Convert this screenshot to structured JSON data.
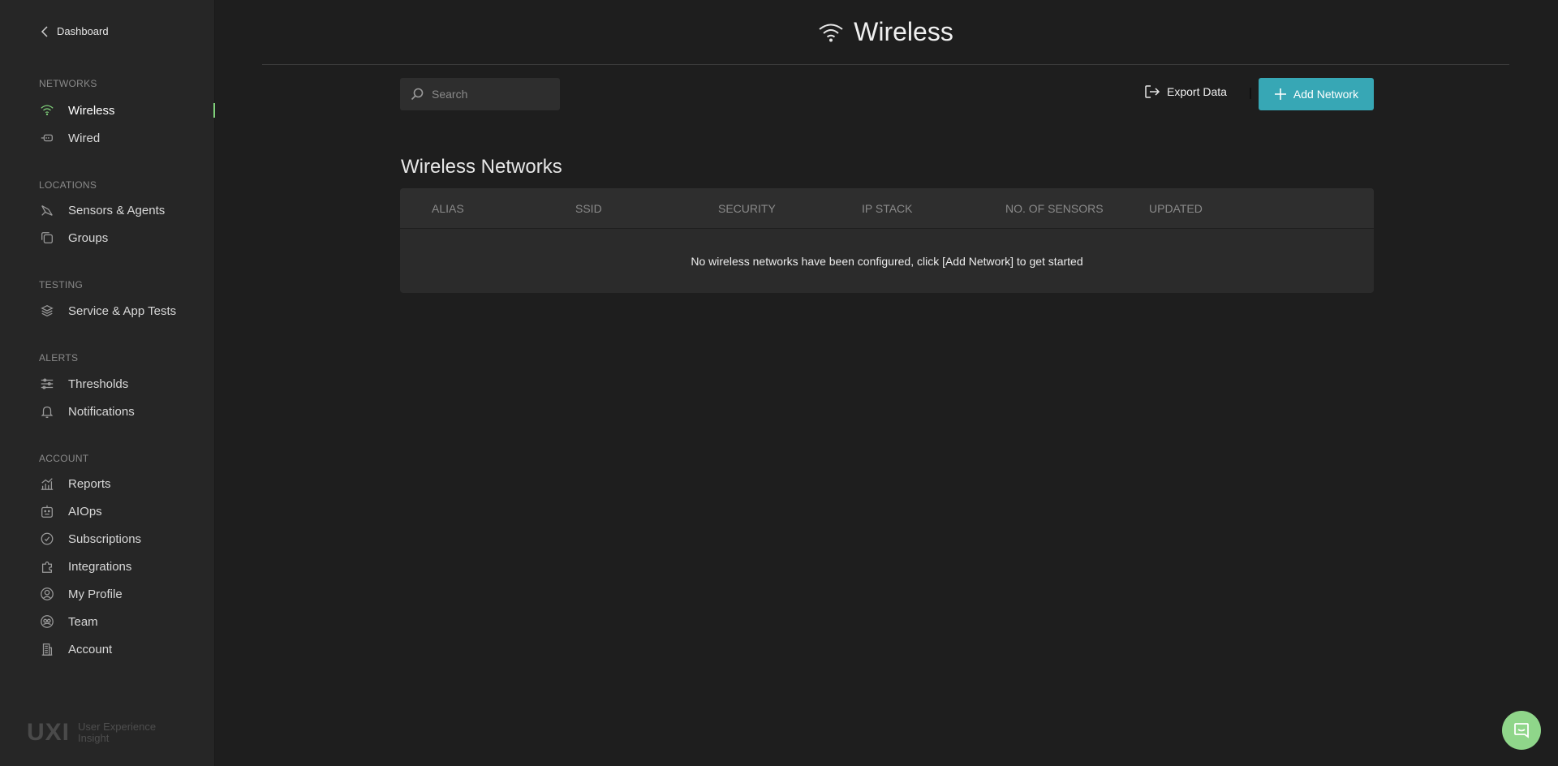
{
  "sidebar": {
    "back_label": "Dashboard",
    "sections": {
      "networks": "NETWORKS",
      "locations": "LOCATIONS",
      "testing": "TESTING",
      "alerts": "ALERTS",
      "account": "ACCOUNT"
    },
    "items": {
      "wireless": "Wireless",
      "wired": "Wired",
      "sensors": "Sensors & Agents",
      "groups": "Groups",
      "tests": "Service & App Tests",
      "thresholds": "Thresholds",
      "notifications": "Notifications",
      "reports": "Reports",
      "aiops": "AIOps",
      "subscriptions": "Subscriptions",
      "integrations": "Integrations",
      "profile": "My Profile",
      "team": "Team",
      "account": "Account"
    },
    "active_item": "wireless",
    "brand": {
      "logo": "UXI",
      "tag_line1": "User Experience",
      "tag_line2": "Insight"
    }
  },
  "header": {
    "title": "Wireless",
    "icon": "wifi-icon"
  },
  "toolbar": {
    "search_placeholder": "Search",
    "search_value": "",
    "export_label": "Export Data",
    "add_label": "Add Network"
  },
  "main": {
    "section_title": "Wireless Networks",
    "columns": [
      "ALIAS",
      "SSID",
      "SECURITY",
      "IP STACK",
      "NO. OF SENSORS",
      "UPDATED"
    ],
    "empty_message": "No wireless networks have been configured, click [Add Network] to get started"
  },
  "colors": {
    "accent": "#37a7b5",
    "active": "#7fd07a",
    "chat": "#8fd68a"
  }
}
